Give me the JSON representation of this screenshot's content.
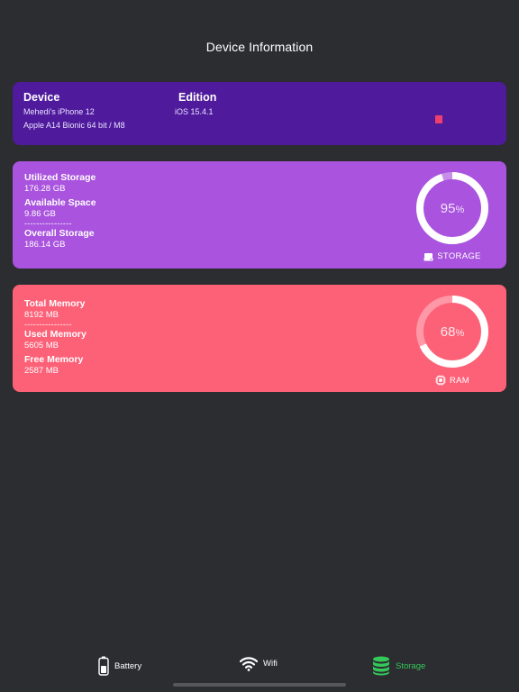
{
  "page": {
    "title": "Device Information"
  },
  "device": {
    "device_label": "Device",
    "device_name": "Mehedi's iPhone 12",
    "chip": "Apple A14 Bionic 64 bit / M8",
    "edition_label": "Edition",
    "edition_value": "iOS 15.4.1"
  },
  "storage": {
    "utilized_label": "Utilized Storage",
    "utilized_value": "176.28 GB",
    "available_label": "Available Space",
    "available_value": "9.86 GB",
    "separator": "----------------",
    "overall_label": "Overall Storage",
    "overall_value": "186.14 GB",
    "percent": "95",
    "percent_sign": "%",
    "percent_fraction": 0.95,
    "chip_label": "STORAGE",
    "chip_icon": "drive-icon"
  },
  "ram": {
    "total_label": "Total Memory",
    "total_value": "8192 MB",
    "separator": "----------------",
    "used_label": "Used Memory",
    "used_value": "5605 MB",
    "free_label": "Free Memory",
    "free_value": "2587 MB",
    "percent": "68",
    "percent_sign": "%",
    "percent_fraction": 0.68,
    "chip_label": "RAM",
    "chip_icon": "cpu-icon"
  },
  "tabbar": {
    "battery_label": "Battery",
    "wifi_label": "Wifi",
    "storage_label": "Storage",
    "active_tab": "Storage",
    "active_color": "#34c759"
  },
  "colors": {
    "background": "#2c2d31",
    "device_card": "#4f1a9c",
    "storage_card": "#a953de",
    "ram_card": "#fd6178"
  }
}
